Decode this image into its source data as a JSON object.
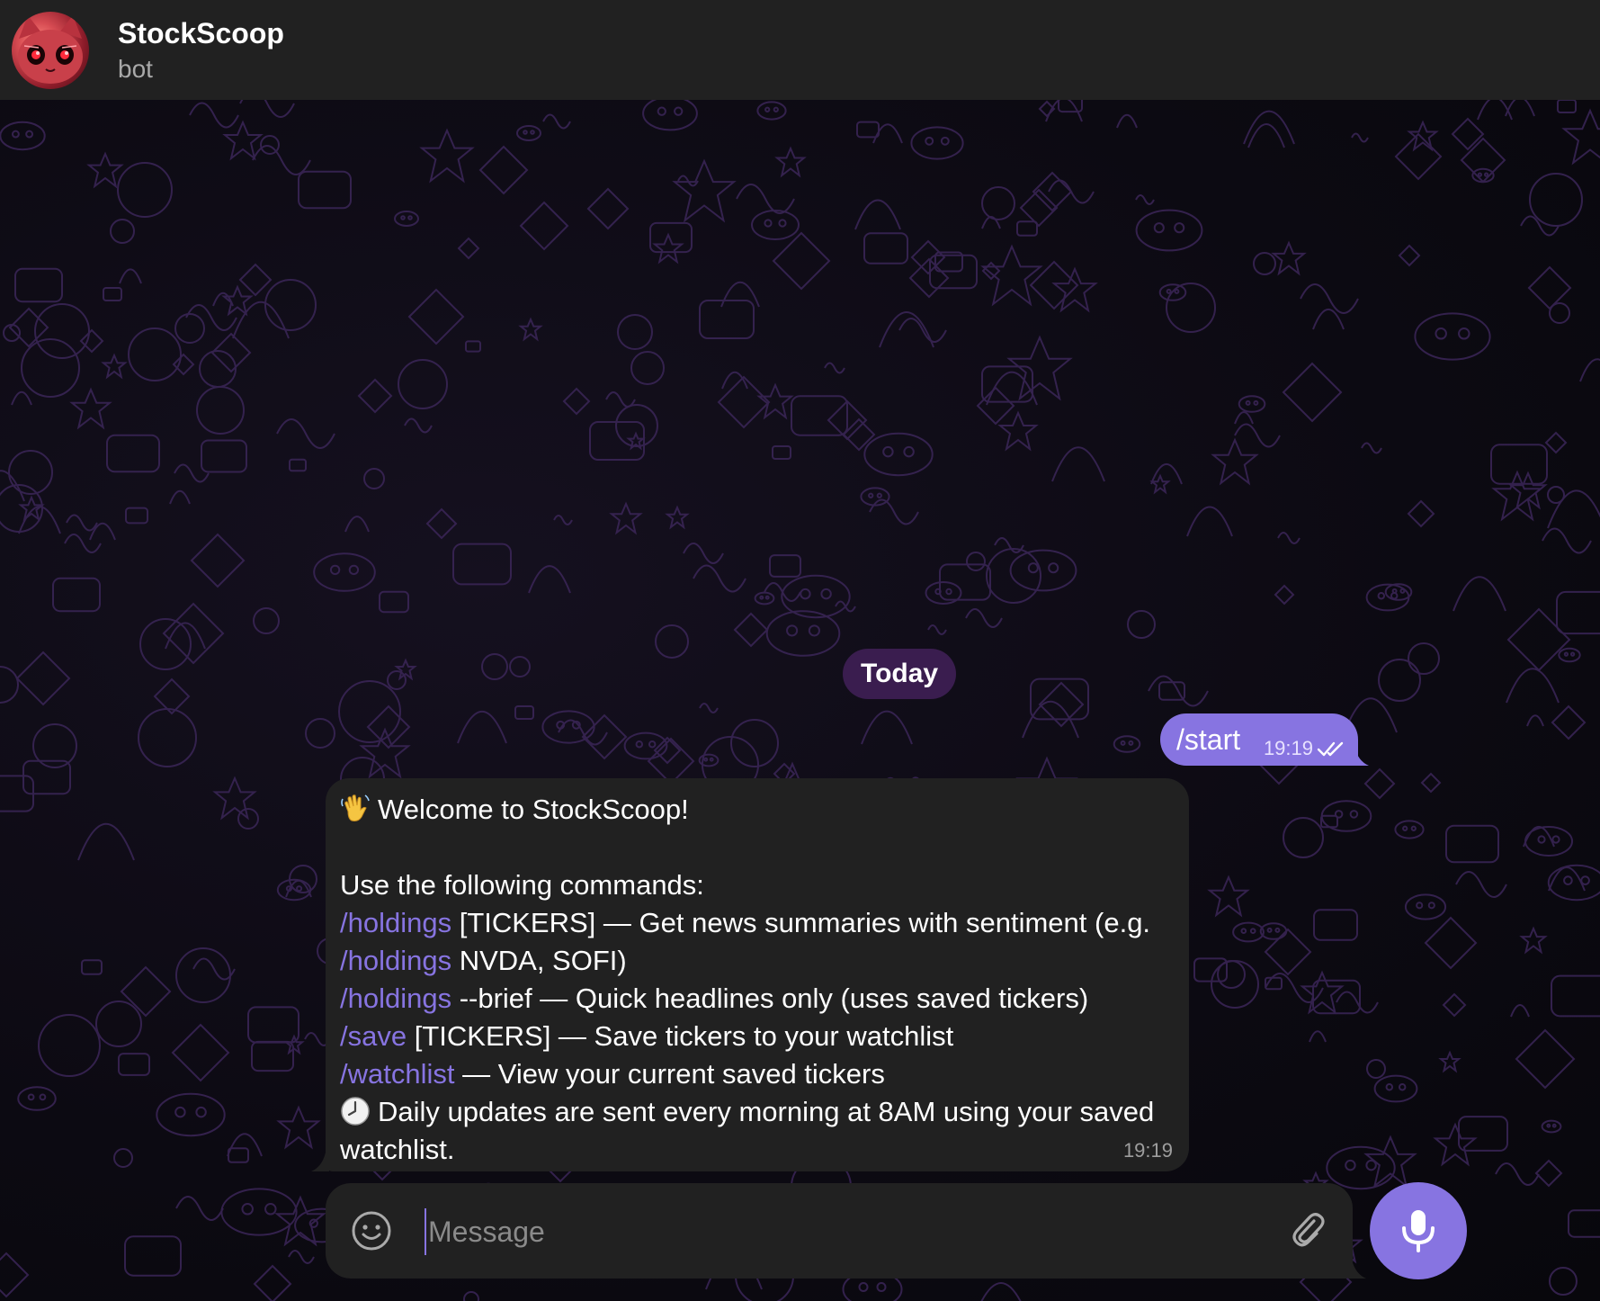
{
  "header": {
    "title": "StockScoop",
    "subtitle": "bot",
    "avatar_icon": "red-cat-avatar"
  },
  "chat": {
    "date_separator": "Today",
    "messages": [
      {
        "direction": "outgoing",
        "text": "/start",
        "time": "19:19",
        "status_icon": "double-check-icon"
      },
      {
        "direction": "incoming",
        "time": "19:19",
        "lines": [
          {
            "emoji": "waving-hand",
            "text": "Welcome to StockScoop!"
          },
          {
            "text": ""
          },
          {
            "text": "Use the following commands:"
          },
          {
            "cmd": "/holdings",
            "text": " [TICKERS] — Get news summaries with sentiment (e.g."
          },
          {
            "cmd": "/holdings",
            "text": " NVDA, SOFI)"
          },
          {
            "cmd": "/holdings",
            "text": " --brief — Quick headlines only (uses saved tickers)"
          },
          {
            "cmd": "/save",
            "text": " [TICKERS] — Save tickers to your watchlist"
          },
          {
            "cmd": "/watchlist",
            "text": " — View your current saved tickers"
          },
          {
            "emoji": "clock",
            "text": "Daily updates are sent every morning at 8AM using your saved"
          },
          {
            "text": "watchlist."
          }
        ]
      }
    ]
  },
  "composer": {
    "placeholder": "Message",
    "value": ""
  },
  "colors": {
    "accent": "#8774e1",
    "header_bg": "#212121",
    "bubble_in": "#212121",
    "bubble_out": "#8774e1",
    "date_pill": "#3a1d4f",
    "pattern_stroke": "#3b2658"
  }
}
